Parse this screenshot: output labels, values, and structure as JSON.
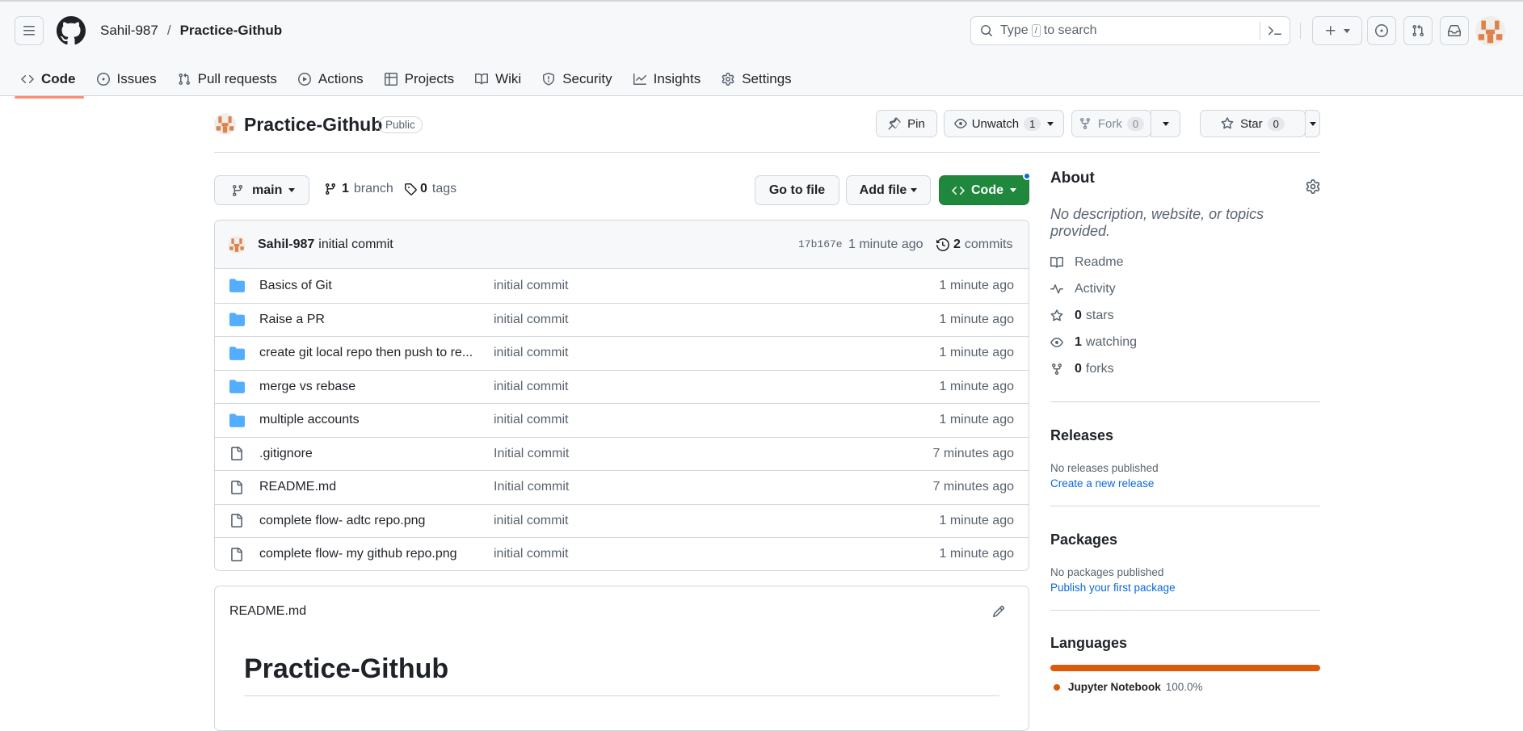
{
  "header": {
    "owner": "Sahil-987",
    "separator": "/",
    "repo": "Practice-Github",
    "search_prefix": "Type",
    "search_key": "/",
    "search_suffix": "to search"
  },
  "tabs": [
    {
      "label": "Code"
    },
    {
      "label": "Issues"
    },
    {
      "label": "Pull requests"
    },
    {
      "label": "Actions"
    },
    {
      "label": "Projects"
    },
    {
      "label": "Wiki"
    },
    {
      "label": "Security"
    },
    {
      "label": "Insights"
    },
    {
      "label": "Settings"
    }
  ],
  "repo_header": {
    "name": "Practice-Github",
    "visibility": "Public",
    "pin_label": "Pin",
    "watch_label": "Unwatch",
    "watch_count": "1",
    "fork_label": "Fork",
    "fork_count": "0",
    "star_label": "Star",
    "star_count": "0"
  },
  "branch_bar": {
    "branch": "main",
    "branch_count": "1",
    "branch_word": "branch",
    "tag_count": "0",
    "tag_word": "tags",
    "go_to_file": "Go to file",
    "add_file": "Add file",
    "code": "Code"
  },
  "latest_commit": {
    "author": "Sahil-987",
    "message": "initial commit",
    "hash": "17b167e",
    "time": "1 minute ago",
    "commit_count": "2",
    "commit_word": "commits"
  },
  "files": [
    {
      "type": "dir",
      "name": "Basics of Git",
      "message": "initial commit",
      "time": "1 minute ago"
    },
    {
      "type": "dir",
      "name": "Raise a PR",
      "message": "initial commit",
      "time": "1 minute ago"
    },
    {
      "type": "dir",
      "name": "create git local repo then push to re...",
      "message": "initial commit",
      "time": "1 minute ago"
    },
    {
      "type": "dir",
      "name": "merge vs rebase",
      "message": "initial commit",
      "time": "1 minute ago"
    },
    {
      "type": "dir",
      "name": "multiple accounts",
      "message": "initial commit",
      "time": "1 minute ago"
    },
    {
      "type": "file",
      "name": ".gitignore",
      "message": "Initial commit",
      "time": "7 minutes ago"
    },
    {
      "type": "file",
      "name": "README.md",
      "message": "Initial commit",
      "time": "7 minutes ago"
    },
    {
      "type": "file",
      "name": "complete flow- adtc repo.png",
      "message": "initial commit",
      "time": "1 minute ago"
    },
    {
      "type": "file",
      "name": "complete flow- my github repo.png",
      "message": "initial commit",
      "time": "1 minute ago"
    }
  ],
  "readme": {
    "filename": "README.md",
    "heading": "Practice-Github"
  },
  "about": {
    "title": "About",
    "description": "No description, website, or topics provided.",
    "readme": "Readme",
    "activity": "Activity",
    "stars_count": "0",
    "stars_word": "stars",
    "watching_count": "1",
    "watching_word": "watching",
    "forks_count": "0",
    "forks_word": "forks"
  },
  "releases": {
    "title": "Releases",
    "empty": "No releases published",
    "link": "Create a new release"
  },
  "packages": {
    "title": "Packages",
    "empty": "No packages published",
    "link": "Publish your first package"
  },
  "languages": {
    "title": "Languages",
    "items": [
      {
        "name": "Jupyter Notebook",
        "percent": "100.0%",
        "fraction": 1.0,
        "color": "#DA5B0B"
      }
    ]
  },
  "colors": {
    "accent_green": "#1f883d",
    "link_blue": "#0969da",
    "tab_underline": "#fd8c73",
    "folder": "#54aeff",
    "notification_dot": "#0969da"
  }
}
